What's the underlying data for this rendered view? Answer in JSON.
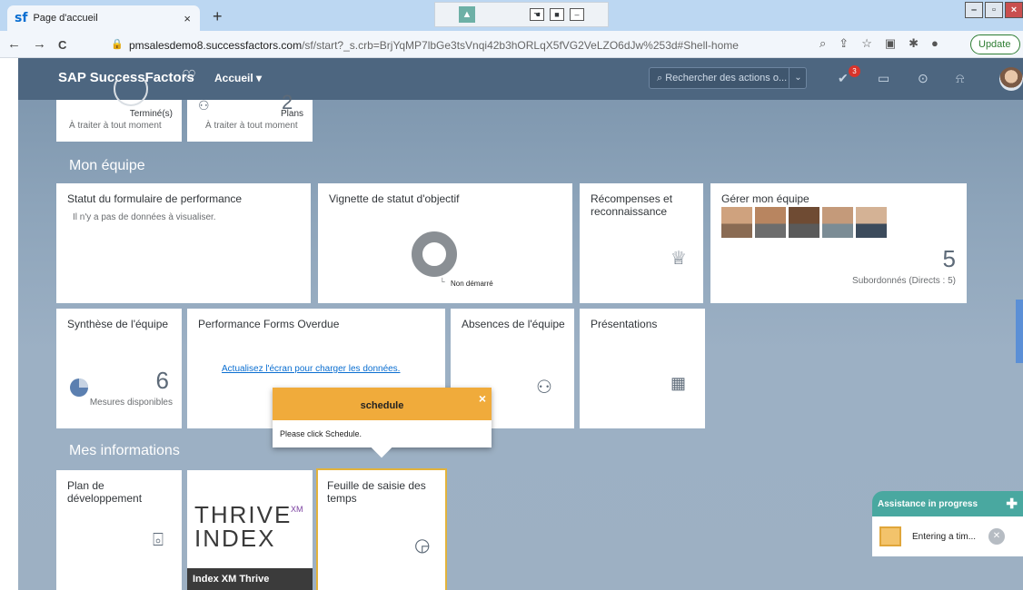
{
  "browser": {
    "tab_title": "Page d'accueil",
    "tab_favicon": "sf",
    "tab_close": "×",
    "new_tab": "+",
    "url_host": "pmsalesdemo8.successfactors.com",
    "url_path": "/sf/start?_s.crb=BrjYqMP7lbGe3tsVnqi42b3hORLqX5fVG2VeLZO6dJw%253d#Shell-home",
    "update_label": "Update",
    "back": "←",
    "forward": "→",
    "reload": "C"
  },
  "header": {
    "brand": "SAP SuccessFactors",
    "home_menu": "Accueil ▾",
    "search_placeholder": "Rechercher des actions o...",
    "notification_count": "3"
  },
  "top_tiles": {
    "completed_label": "Terminé(s)",
    "completed_sub": "À traiter à tout moment",
    "plans_value": "2",
    "plans_label": "Plans",
    "plans_sub": "À traiter à tout moment"
  },
  "team": {
    "section_title": "Mon équipe",
    "perf_form_title": "Statut du formulaire de performance",
    "perf_form_empty": "Il n'y a pas de données à visualiser.",
    "goal_title": "Vignette de statut d'objectif",
    "goal_status": "Non démarré",
    "rewards_title": "Récompenses et reconnaissance",
    "manage_title": "Gérer mon équipe",
    "manage_count": "5",
    "manage_sub": "Subordonnés (Directs : 5)",
    "synth_title": "Synthèse de l'équipe",
    "synth_value": "6",
    "synth_sub": "Mesures disponibles",
    "overdue_title": "Performance Forms Overdue",
    "overdue_link": "Actualisez l'écran pour charger les données.",
    "absences_title": "Absences de l'équipe",
    "presentations_title": "Présentations"
  },
  "info": {
    "section_title": "Mes informations",
    "devplan_title": "Plan de développement",
    "thrive_logo_line1": "THRIVE",
    "thrive_logo_sup": "XM",
    "thrive_logo_line2": "INDEX",
    "thrive_caption": "Index XM Thrive",
    "timesheet_title": "Feuille de saisie des temps"
  },
  "popover": {
    "title": "schedule",
    "body": "Please click Schedule.",
    "close": "×"
  },
  "assist": {
    "title": "Assistance in progress",
    "step": "Entering a tim..."
  }
}
